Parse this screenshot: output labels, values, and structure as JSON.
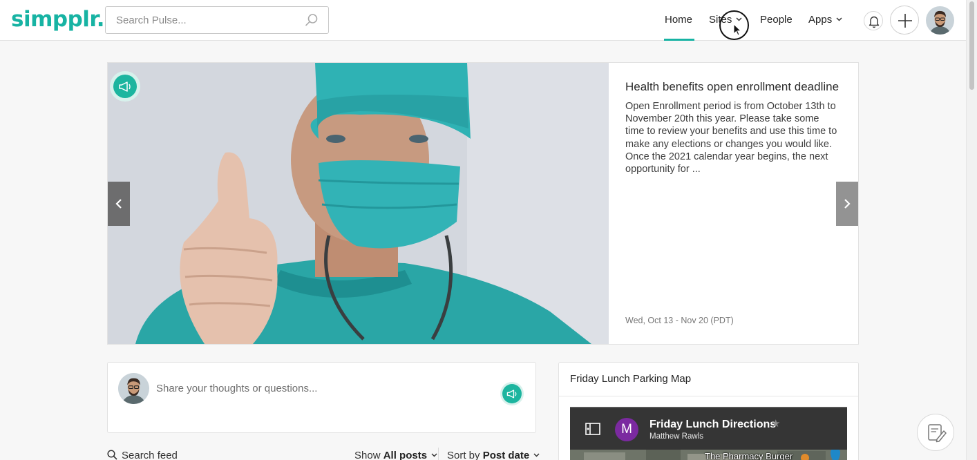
{
  "header": {
    "logo": "simpplr.",
    "search_placeholder": "Search Pulse...",
    "nav": {
      "home": "Home",
      "sites": "Sites",
      "people": "People",
      "apps": "Apps"
    },
    "accent_color": "#17b3a3"
  },
  "carousel": {
    "title": "Health benefits open enrollment deadline",
    "body": "Open Enrollment period is from October 13th to November 20th this year. Please take some time to review your benefits and use this time to make any elections or changes you would like. Once the 2021 calendar year begins, the next opportunity for ...",
    "date": "Wed, Oct 13 - Nov 20 (PDT)"
  },
  "share": {
    "placeholder": "Share your thoughts or questions..."
  },
  "feed": {
    "search_label": "Search feed",
    "show_prefix": "Show",
    "show_value": "All posts",
    "sort_prefix": "Sort by",
    "sort_value": "Post date"
  },
  "widget": {
    "title": "Friday Lunch Parking Map",
    "map_title": "Friday Lunch Directions",
    "map_owner": "Matthew Rawls",
    "map_initial": "M",
    "map_place_label": "The Pharmacy Burger"
  }
}
